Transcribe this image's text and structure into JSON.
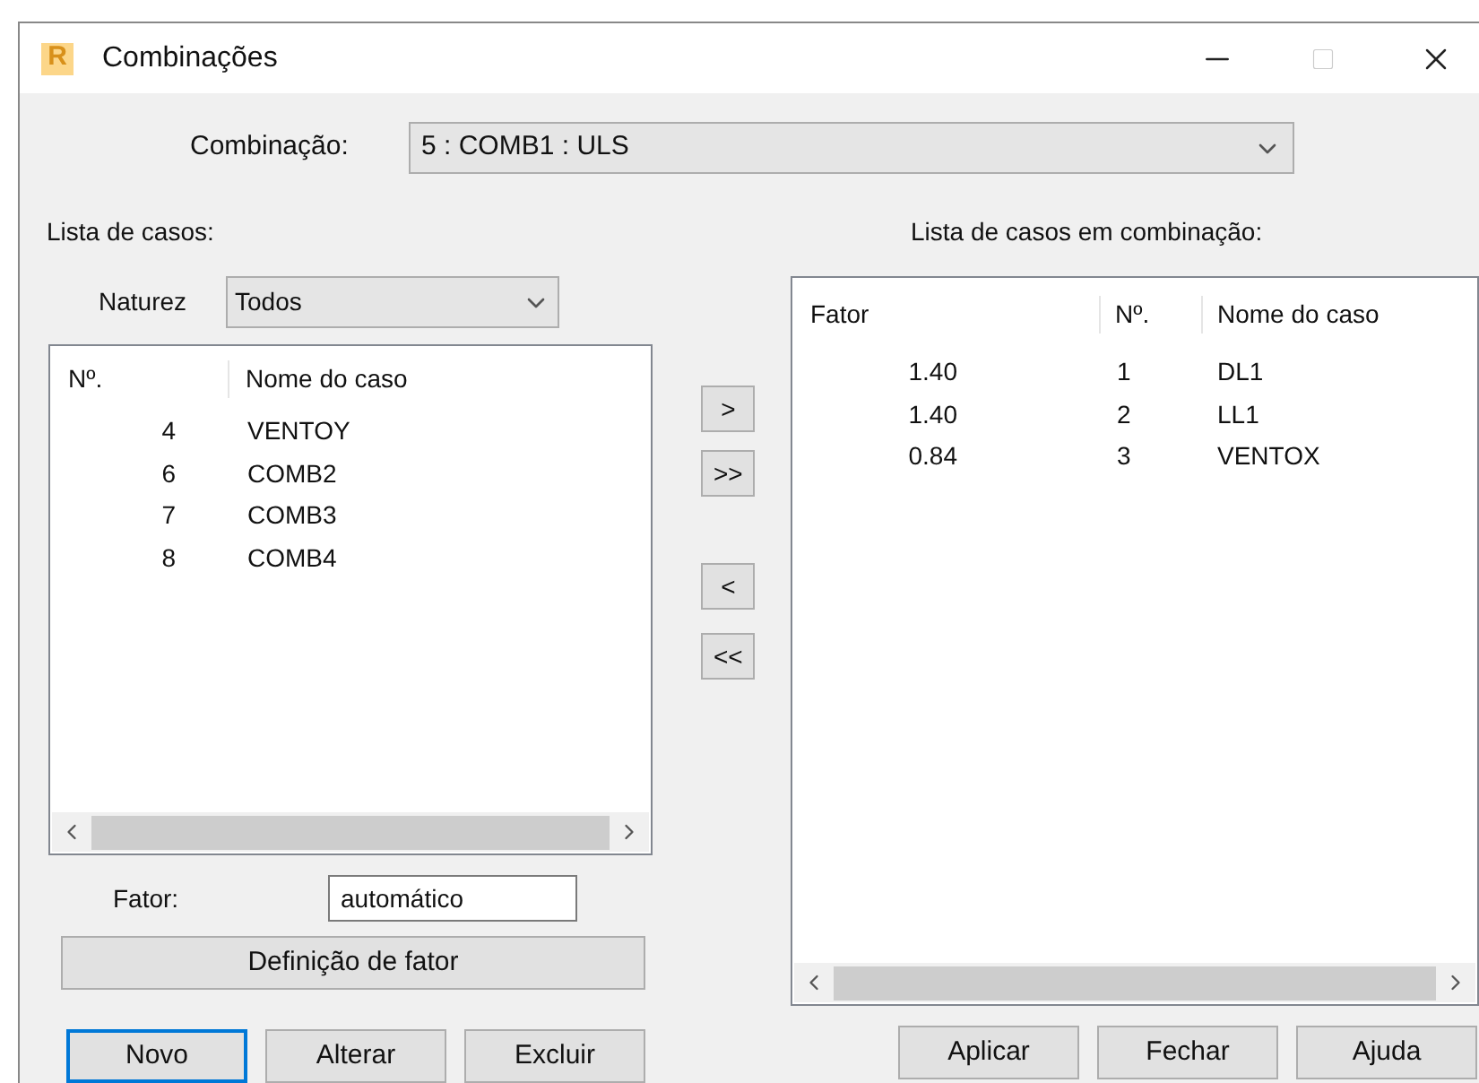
{
  "window": {
    "title": "Combinações",
    "icon_letter": "R"
  },
  "combination": {
    "label": "Combinação:",
    "value": "5 : COMB1 : ULS"
  },
  "cases": {
    "title": "Lista de casos:",
    "nature_label": "Naturez",
    "nature_value": "Todos",
    "columns": [
      "Nº.",
      "Nome do caso"
    ],
    "rows": [
      {
        "number": "4",
        "name": "VENTOY"
      },
      {
        "number": "6",
        "name": "COMB2"
      },
      {
        "number": "7",
        "name": "COMB3"
      },
      {
        "number": "8",
        "name": "COMB4"
      }
    ]
  },
  "factor": {
    "label": "Fator:",
    "value": "automático",
    "definition_button": "Definição de fator"
  },
  "transfer_buttons": [
    ">",
    ">>",
    "<",
    "<<"
  ],
  "combination_cases": {
    "title": "Lista de casos em combinação:",
    "columns": [
      "Fator",
      "Nº.",
      "Nome do caso"
    ],
    "rows": [
      {
        "factor": "1.40",
        "number": "1",
        "name": "DL1"
      },
      {
        "factor": "1.40",
        "number": "2",
        "name": "LL1"
      },
      {
        "factor": "0.84",
        "number": "3",
        "name": "VENTOX"
      }
    ]
  },
  "left_buttons": [
    {
      "label": "Novo",
      "focused": true
    },
    {
      "label": "Alterar",
      "focused": false
    },
    {
      "label": "Excluir",
      "focused": false
    }
  ],
  "right_buttons": [
    {
      "label": "Aplicar",
      "focused": false
    },
    {
      "label": "Fechar",
      "focused": false
    },
    {
      "label": "Ajuda",
      "focused": false
    }
  ]
}
